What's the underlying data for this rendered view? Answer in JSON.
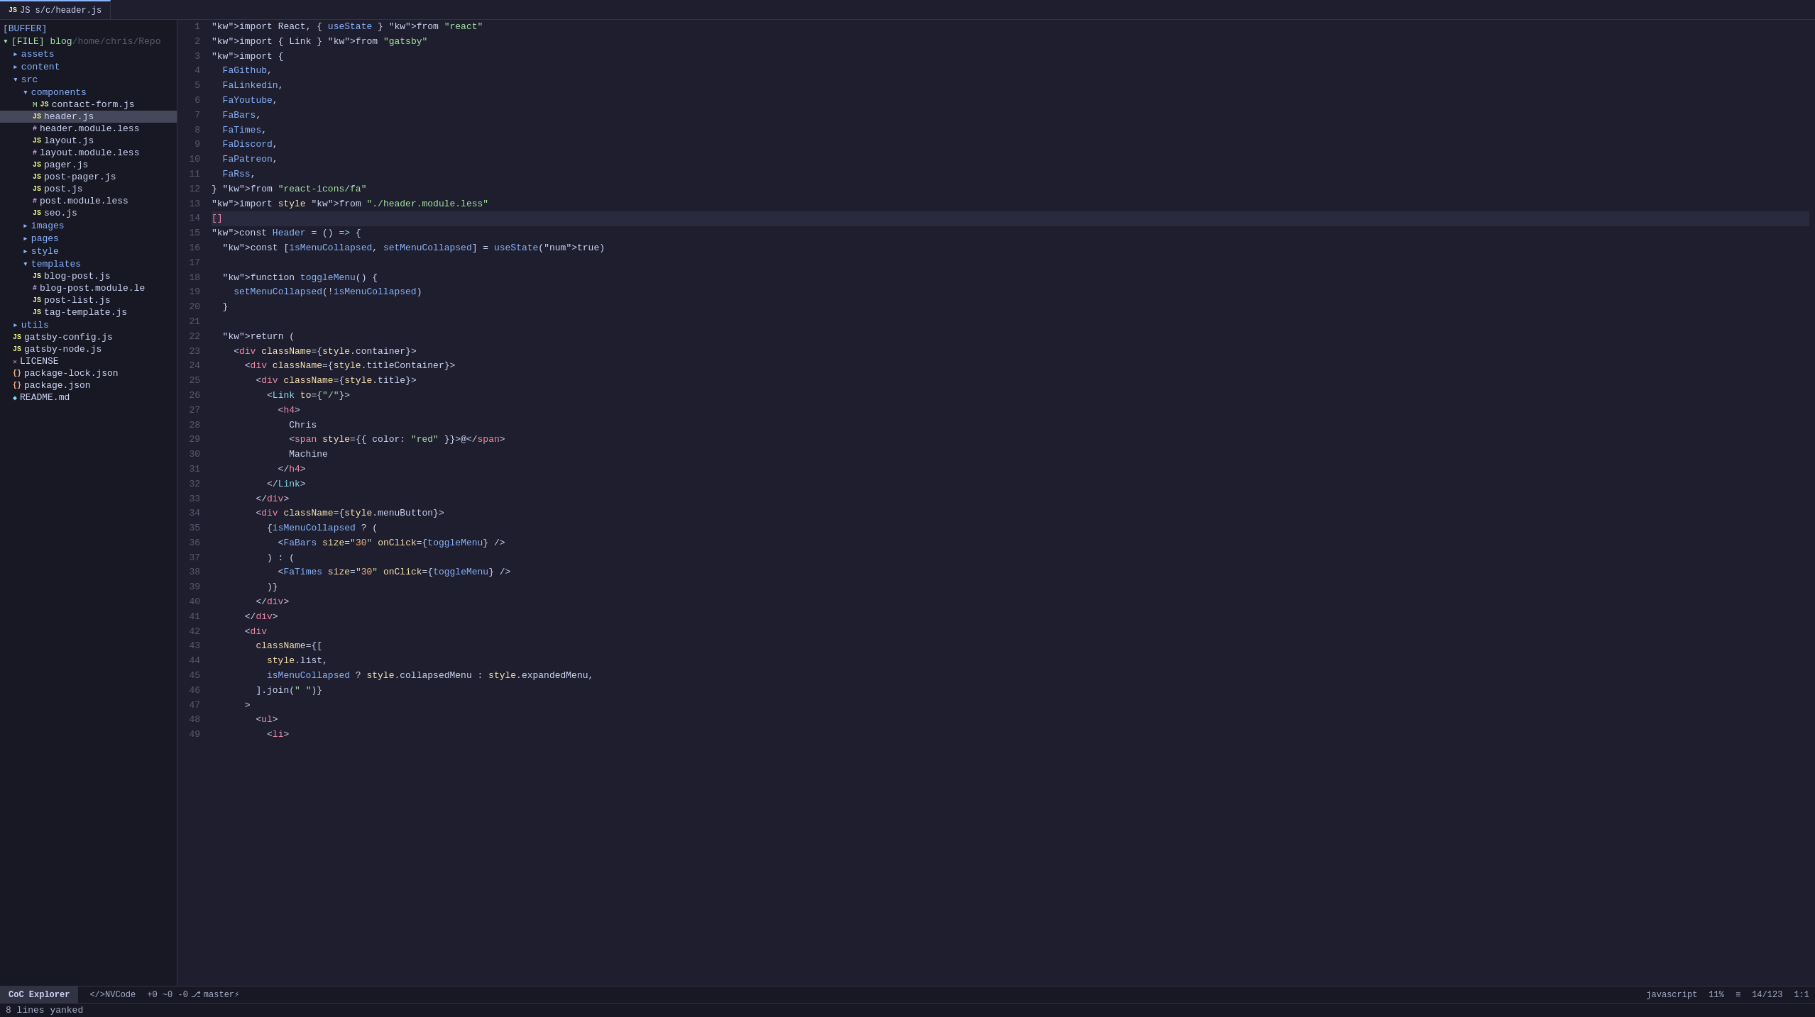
{
  "tab": {
    "label": "JS s/c/header.js",
    "active": true
  },
  "sidebar": {
    "title": "[BUFFER]",
    "items": [
      {
        "id": "file-root",
        "label": "[FILE] blog",
        "path": "/home/chris/Repo",
        "indent": 0,
        "type": "file-root",
        "icon": "▾"
      },
      {
        "id": "assets",
        "label": "assets",
        "indent": 1,
        "type": "folder",
        "icon": "▸"
      },
      {
        "id": "content",
        "label": "content",
        "indent": 1,
        "type": "folder",
        "icon": "▸"
      },
      {
        "id": "src",
        "label": "src",
        "indent": 1,
        "type": "folder",
        "icon": "▾"
      },
      {
        "id": "components",
        "label": "components",
        "indent": 2,
        "type": "folder",
        "icon": "▾"
      },
      {
        "id": "contact-form",
        "label": "contact-form.js",
        "indent": 3,
        "type": "js",
        "modified": "M"
      },
      {
        "id": "header",
        "label": "header.js",
        "indent": 3,
        "type": "js",
        "selected": true
      },
      {
        "id": "header-module",
        "label": "header.module.less",
        "indent": 3,
        "type": "less"
      },
      {
        "id": "layout",
        "label": "layout.js",
        "indent": 3,
        "type": "js"
      },
      {
        "id": "layout-module",
        "label": "layout.module.less",
        "indent": 3,
        "type": "less"
      },
      {
        "id": "pager",
        "label": "pager.js",
        "indent": 3,
        "type": "js"
      },
      {
        "id": "post-pager",
        "label": "post-pager.js",
        "indent": 3,
        "type": "js"
      },
      {
        "id": "post",
        "label": "post.js",
        "indent": 3,
        "type": "js"
      },
      {
        "id": "post-module",
        "label": "post.module.less",
        "indent": 3,
        "type": "less"
      },
      {
        "id": "seo",
        "label": "seo.js",
        "indent": 3,
        "type": "js"
      },
      {
        "id": "images",
        "label": "images",
        "indent": 2,
        "type": "folder",
        "icon": "▸"
      },
      {
        "id": "pages",
        "label": "pages",
        "indent": 2,
        "type": "folder",
        "icon": "▸"
      },
      {
        "id": "style",
        "label": "style",
        "indent": 2,
        "type": "folder",
        "icon": "▸"
      },
      {
        "id": "templates",
        "label": "templates",
        "indent": 2,
        "type": "folder",
        "icon": "▾"
      },
      {
        "id": "blog-post-js",
        "label": "blog-post.js",
        "indent": 3,
        "type": "js"
      },
      {
        "id": "blog-post-module",
        "label": "blog-post.module.le",
        "indent": 3,
        "type": "less"
      },
      {
        "id": "post-list",
        "label": "post-list.js",
        "indent": 3,
        "type": "js"
      },
      {
        "id": "tag-template",
        "label": "tag-template.js",
        "indent": 3,
        "type": "js"
      },
      {
        "id": "utils",
        "label": "utils",
        "indent": 1,
        "type": "folder",
        "icon": "▸"
      },
      {
        "id": "gatsby-config",
        "label": "gatsby-config.js",
        "indent": 1,
        "type": "js"
      },
      {
        "id": "gatsby-node",
        "label": "gatsby-node.js",
        "indent": 1,
        "type": "js"
      },
      {
        "id": "LICENSE",
        "label": "LICENSE",
        "indent": 1,
        "type": "other"
      },
      {
        "id": "package-lock",
        "label": "package-lock.json",
        "indent": 1,
        "type": "json"
      },
      {
        "id": "package-json",
        "label": "package.json",
        "indent": 1,
        "type": "json"
      },
      {
        "id": "readme",
        "label": "README.md",
        "indent": 1,
        "type": "md"
      }
    ]
  },
  "editor": {
    "lines": [
      {
        "n": 1,
        "code": "import React, { useState } from \"react\""
      },
      {
        "n": 2,
        "code": "import { Link } from \"gatsby\""
      },
      {
        "n": 3,
        "code": "import {"
      },
      {
        "n": 4,
        "code": "  FaGithub,"
      },
      {
        "n": 5,
        "code": "  FaLinkedin,"
      },
      {
        "n": 6,
        "code": "  FaYoutube,"
      },
      {
        "n": 7,
        "code": "  FaBars,"
      },
      {
        "n": 8,
        "code": "  FaTimes,"
      },
      {
        "n": 9,
        "code": "  FaDiscord,"
      },
      {
        "n": 10,
        "code": "  FaPatreon,"
      },
      {
        "n": 11,
        "code": "  FaRss,"
      },
      {
        "n": 12,
        "code": "} from \"react-icons/fa\""
      },
      {
        "n": 13,
        "code": "import style from \"./header.module.less\""
      },
      {
        "n": 14,
        "code": "[]",
        "highlighted": true
      },
      {
        "n": 15,
        "code": "const Header = () => {"
      },
      {
        "n": 16,
        "code": "  const [isMenuCollapsed, setMenuCollapsed] = useState(true)"
      },
      {
        "n": 17,
        "code": ""
      },
      {
        "n": 18,
        "code": "  function toggleMenu() {"
      },
      {
        "n": 19,
        "code": "    setMenuCollapsed(!isMenuCollapsed)"
      },
      {
        "n": 20,
        "code": "  }"
      },
      {
        "n": 21,
        "code": ""
      },
      {
        "n": 22,
        "code": "  return ("
      },
      {
        "n": 23,
        "code": "    <div className={style.container}>"
      },
      {
        "n": 24,
        "code": "      <div className={style.titleContainer}>"
      },
      {
        "n": 25,
        "code": "        <div className={style.title}>"
      },
      {
        "n": 26,
        "code": "          <Link to={\"/\"}>"
      },
      {
        "n": 27,
        "code": "            <h4>"
      },
      {
        "n": 28,
        "code": "              Chris"
      },
      {
        "n": 29,
        "code": "              <span style={{ color: \"red\" }}>@</span>"
      },
      {
        "n": 30,
        "code": "              Machine"
      },
      {
        "n": 31,
        "code": "            </h4>"
      },
      {
        "n": 32,
        "code": "          </Link>"
      },
      {
        "n": 33,
        "code": "        </div>"
      },
      {
        "n": 34,
        "code": "        <div className={style.menuButton}>"
      },
      {
        "n": 35,
        "code": "          {isMenuCollapsed ? ("
      },
      {
        "n": 36,
        "code": "            <FaBars size=\"30\" onClick={toggleMenu} />"
      },
      {
        "n": 37,
        "code": "          ) : ("
      },
      {
        "n": 38,
        "code": "            <FaTimes size=\"30\" onClick={toggleMenu} />"
      },
      {
        "n": 39,
        "code": "          )}"
      },
      {
        "n": 40,
        "code": "        </div>"
      },
      {
        "n": 41,
        "code": "      </div>"
      },
      {
        "n": 42,
        "code": "      <div"
      },
      {
        "n": 43,
        "code": "        className={["
      },
      {
        "n": 44,
        "code": "          style.list,"
      },
      {
        "n": 45,
        "code": "          isMenuCollapsed ? style.collapsedMenu : style.expandedMenu,"
      },
      {
        "n": 46,
        "code": "        ].join(\" \")}"
      },
      {
        "n": 47,
        "code": "      >"
      },
      {
        "n": 48,
        "code": "        <ul>"
      },
      {
        "n": 49,
        "code": "          <li>"
      }
    ]
  },
  "status_bar": {
    "left_section": "CoC Explorer",
    "mode": "</>NVCode",
    "git": "+0 ~0 -0",
    "branch": "master⚡",
    "right_lang": "javascript",
    "right_percent": "11%",
    "right_lines": "14/123",
    "right_col": "1:1"
  },
  "bottom_message": "8 lines yanked",
  "colors": {
    "bg": "#1e1e2e",
    "sidebar_bg": "#181825",
    "tab_active_border": "#89b4fa",
    "accent": "#89b4fa",
    "keyword": "#cba6f7",
    "string": "#a6e3a1",
    "jsx_tag": "#f38ba8"
  }
}
